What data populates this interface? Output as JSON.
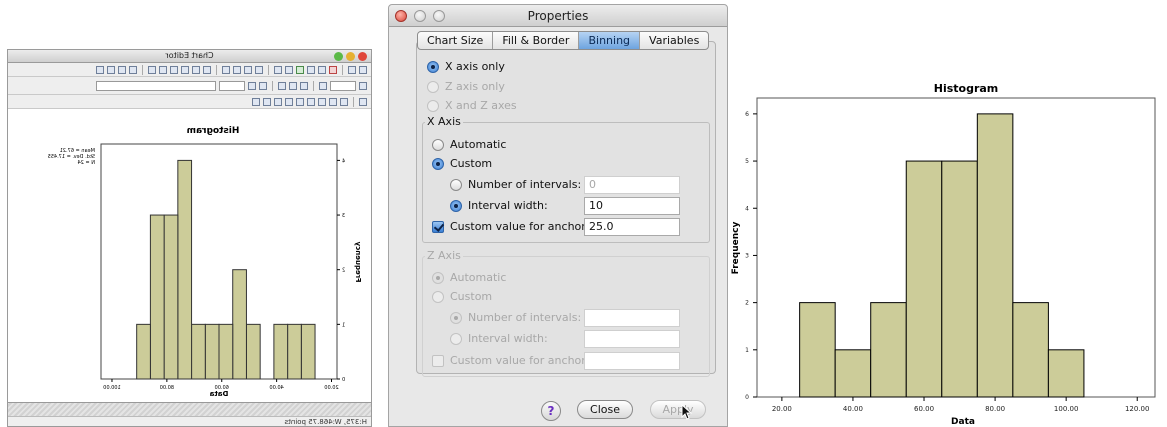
{
  "left": {
    "window_title": "Chart Editor",
    "chart_title": "Histogram",
    "stats": [
      "Mean = 67.21",
      "Std. Dev. = 17.455",
      "N = 24"
    ],
    "x_axis_title": "Data",
    "y_axis_title": "Frequency",
    "status_text": "H:375, W:468.75 points"
  },
  "dialog": {
    "title": "Properties",
    "tabs": [
      {
        "label": "Chart Size",
        "active": false
      },
      {
        "label": "Fill & Border",
        "active": false
      },
      {
        "label": "Binning",
        "active": true
      },
      {
        "label": "Variables",
        "active": false
      }
    ],
    "axis_options": {
      "x_only": {
        "label": "X axis only",
        "selected": true,
        "enabled": true
      },
      "z_only": {
        "label": "Z axis only",
        "selected": false,
        "enabled": false
      },
      "x_and_z": {
        "label": "X and Z axes",
        "selected": false,
        "enabled": false
      }
    },
    "x_axis": {
      "group_label": "X Axis",
      "automatic_label": "Automatic",
      "custom_label": "Custom",
      "mode": "Custom",
      "num_intervals_label": "Number of intervals:",
      "num_intervals_value": "0",
      "interval_width_label": "Interval width:",
      "interval_width_value": "10",
      "interval_mode": "Interval width",
      "anchor_label": "Custom value for anchor:",
      "anchor_checked": true,
      "anchor_value": "25.0"
    },
    "z_axis": {
      "group_label": "Z Axis",
      "automatic_label": "Automatic",
      "custom_label": "Custom",
      "num_intervals_label": "Number of intervals:",
      "interval_width_label": "Interval width:",
      "anchor_label": "Custom value for anchor:",
      "enabled": false
    },
    "help_label": "?",
    "close_label": "Close",
    "apply_label": "Apply"
  },
  "chart_data": [
    {
      "type": "bar",
      "title": "Histogram",
      "xlabel": "Data",
      "ylabel": "Frequency",
      "annotations": [
        "Mean = 67.21",
        "Std. Dev. = 17.455",
        "N = 24"
      ],
      "x_ticks": [
        "20.00",
        "40.00",
        "60.00",
        "80.00",
        "100.00"
      ],
      "y_ticks": [
        "0",
        "1",
        "2",
        "3",
        "4"
      ],
      "xlim": [
        18,
        104
      ],
      "ylim": [
        0,
        4.3
      ],
      "bin_starts": [
        26,
        31,
        36,
        41,
        46,
        51,
        56,
        61,
        66,
        71,
        76,
        81,
        86,
        91,
        96,
        101
      ],
      "bin_width": 5,
      "values": [
        1,
        1,
        1,
        0,
        1,
        2,
        1,
        1,
        1,
        4,
        3,
        3,
        1,
        0,
        0,
        0
      ],
      "bar_fill": "#cccc99",
      "mirrored": true
    },
    {
      "type": "bar",
      "title": "Histogram",
      "xlabel": "Data",
      "ylabel": "Frequency",
      "x_ticks": [
        "20.00",
        "40.00",
        "60.00",
        "80.00",
        "100.00",
        "120.00"
      ],
      "y_ticks": [
        "0",
        "1",
        "2",
        "3",
        "4",
        "5",
        "6"
      ],
      "xlim": [
        13,
        125
      ],
      "ylim": [
        0,
        6.4
      ],
      "bin_starts": [
        25,
        35,
        45,
        55,
        65,
        75,
        85,
        95
      ],
      "bin_width": 10,
      "values": [
        2,
        1,
        2,
        5,
        5,
        6,
        2,
        1
      ],
      "bar_fill": "#cccc99"
    }
  ]
}
